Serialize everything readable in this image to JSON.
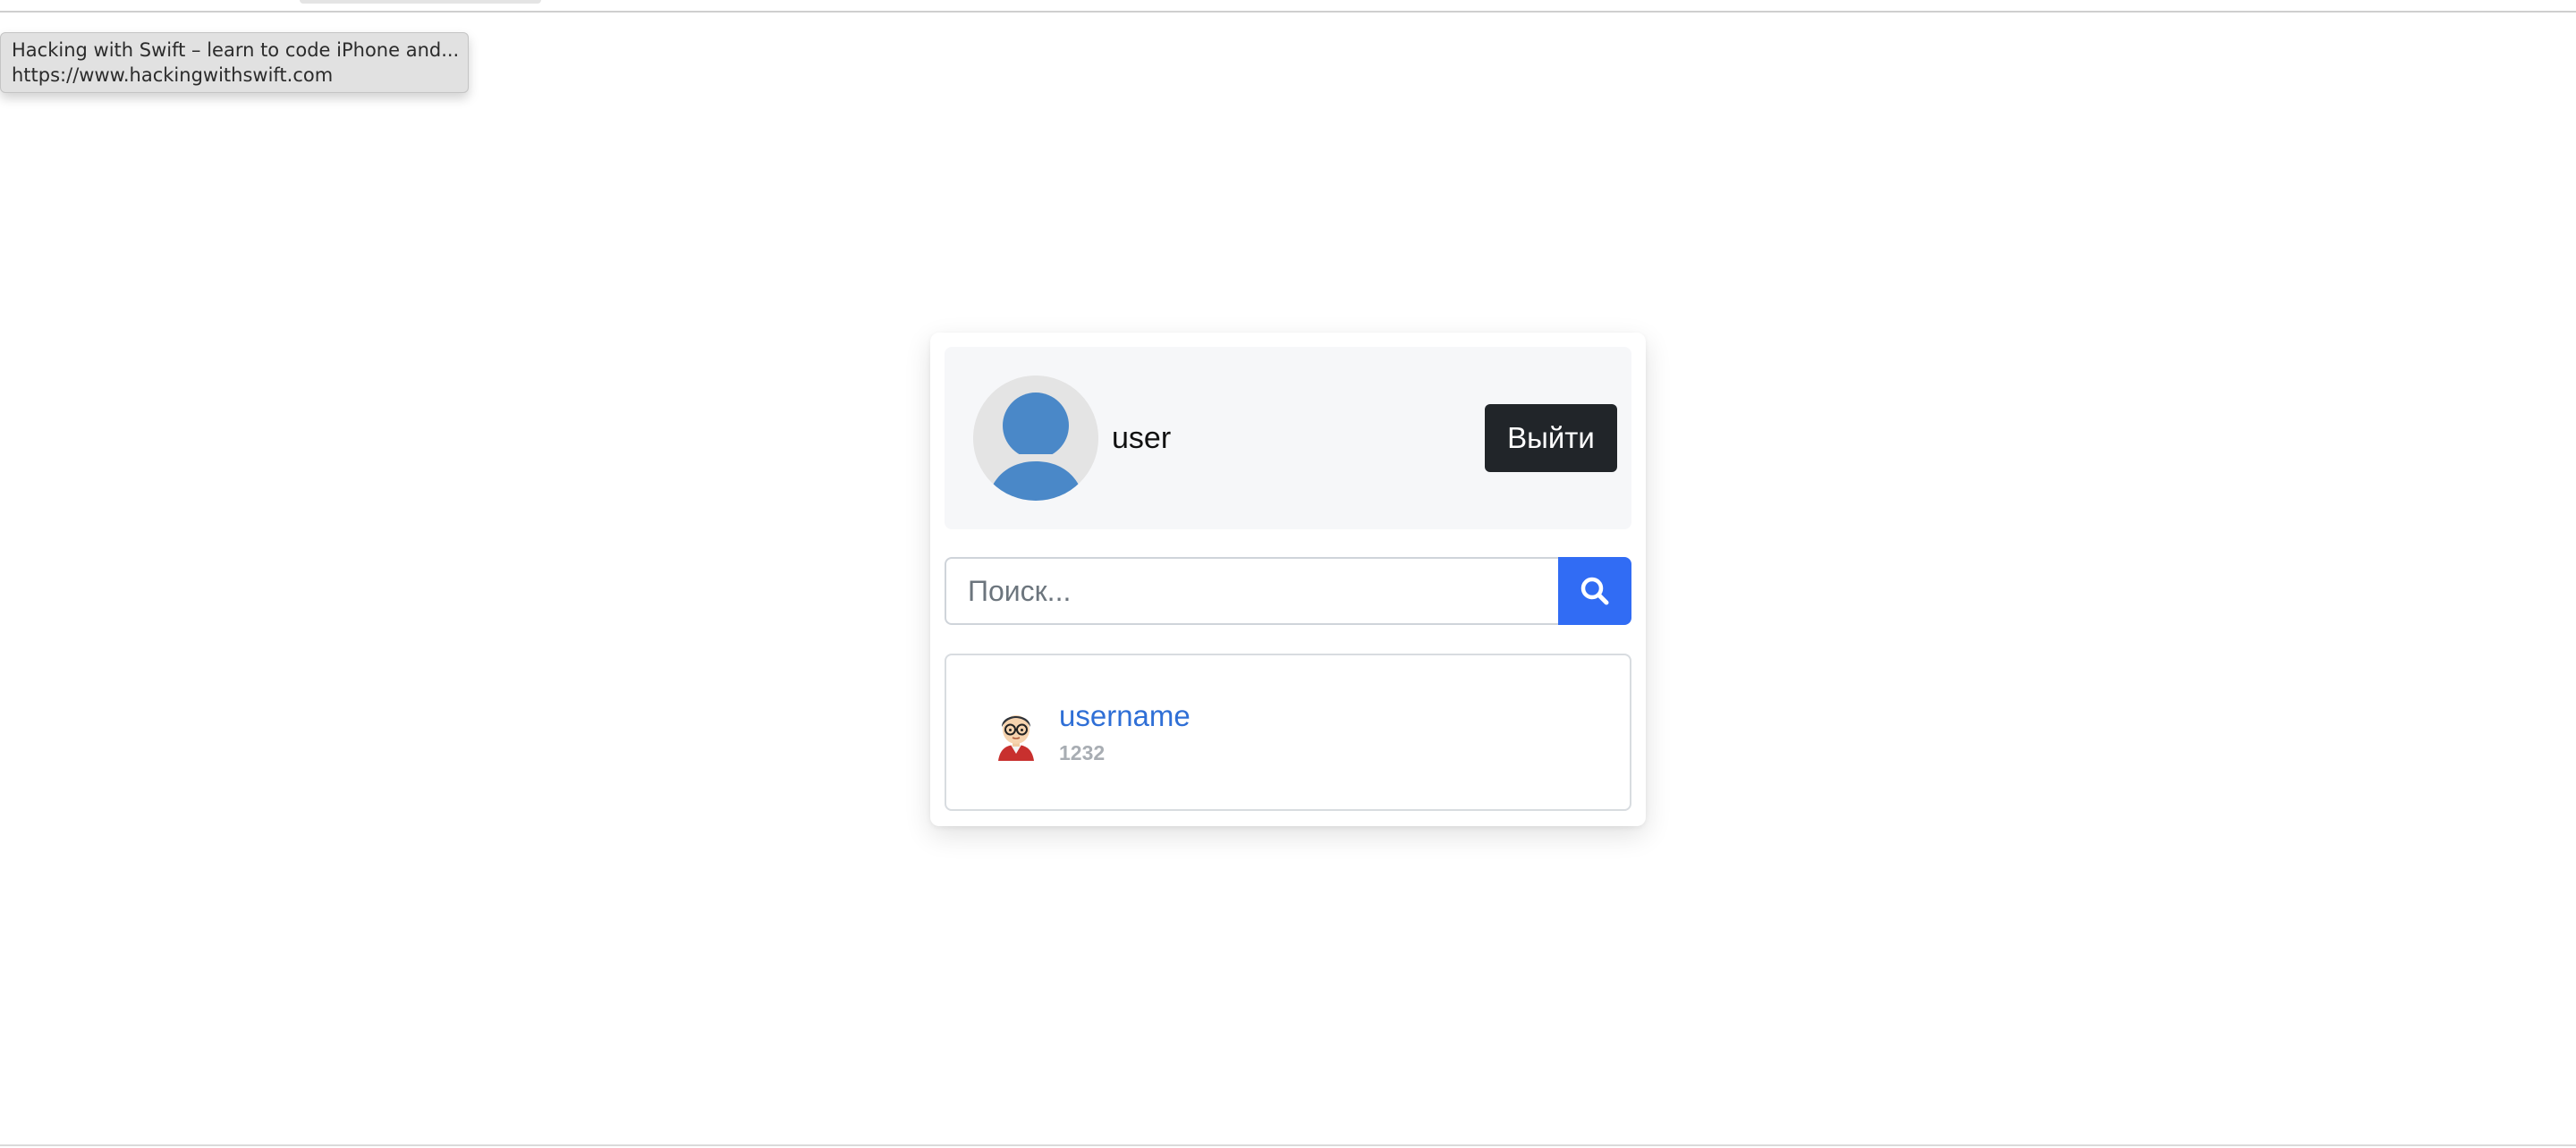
{
  "tooltip": {
    "title": "Hacking with Swift – learn to code iPhone and...",
    "url": "https://www.hackingwithswift.com"
  },
  "profile": {
    "username": "user",
    "logout_label": "Выйти",
    "avatar_color": "#4a88c8"
  },
  "search": {
    "placeholder": "Поиск...",
    "value": "",
    "button_icon": "search-icon",
    "accent": "#316cf4"
  },
  "results": [
    {
      "name": "username",
      "subtitle": "1232",
      "avatar_icon": "user-glasses-avatar-icon"
    }
  ]
}
